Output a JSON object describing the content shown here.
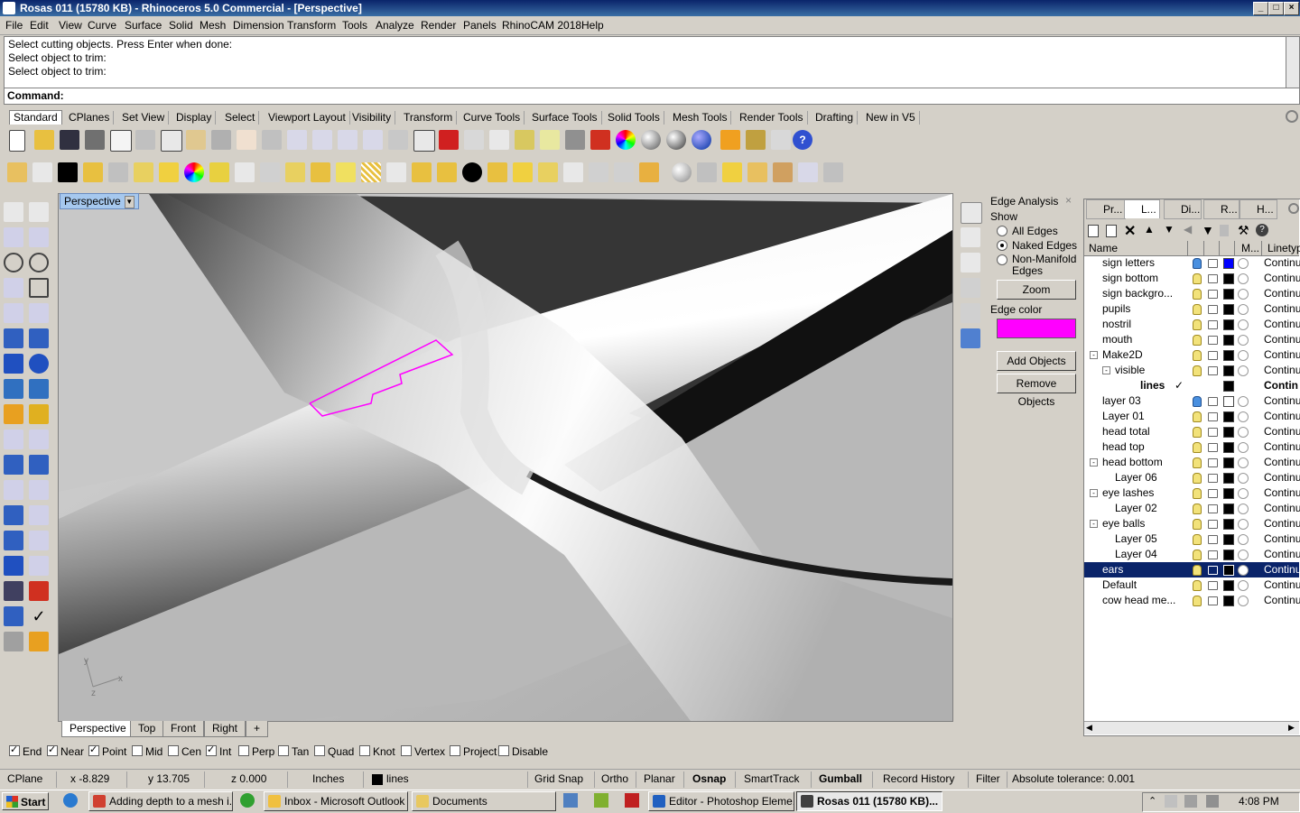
{
  "window": {
    "title": "Rosas 011 (15780 KB) - Rhinoceros 5.0 Commercial - [Perspective]",
    "controls": [
      "_",
      "□",
      "×"
    ]
  },
  "menu": [
    "File",
    "Edit",
    "View",
    "Curve",
    "Surface",
    "Solid",
    "Mesh",
    "Dimension",
    "Transform",
    "Tools",
    "Analyze",
    "Render",
    "Panels",
    "RhinoCAM 2018",
    "Help"
  ],
  "command": {
    "history": [
      "Select cutting objects. Press Enter when done:",
      "Select object to trim:",
      "Select object to trim:"
    ],
    "prompt": "Command:"
  },
  "toolbar_tabs": [
    "Standard",
    "CPlanes",
    "Set View",
    "Display",
    "Select",
    "Viewport Layout",
    "Visibility",
    "Transform",
    "Curve Tools",
    "Surface Tools",
    "Solid Tools",
    "Mesh Tools",
    "Render Tools",
    "Drafting",
    "New in V5"
  ],
  "viewport": {
    "title": "Perspective",
    "tabs": [
      "Perspective",
      "Top",
      "Front",
      "Right",
      "+"
    ],
    "axis_x": "x",
    "axis_y": "y",
    "axis_z": "z"
  },
  "edge_panel": {
    "title": "Edge Analysis",
    "close": "×",
    "show_label": "Show",
    "options": [
      "All Edges",
      "Naked Edges",
      "Non-Manifold Edges"
    ],
    "selected": "Naked Edges",
    "zoom": "Zoom",
    "edge_color_label": "Edge color",
    "edge_color": "#ff00ff",
    "add": "Add Objects",
    "remove": "Remove Objects"
  },
  "layers_panel": {
    "tabs": [
      "Pr...",
      "L...",
      "Di...",
      "R...",
      "H..."
    ],
    "col_name": "Name",
    "col_mat": "M...",
    "col_linetype": "Linetyp",
    "rows": [
      {
        "name": "sign letters",
        "indent": 0,
        "color": "#0000ff",
        "linetype": "Continu",
        "bulb": "blue"
      },
      {
        "name": "sign bottom",
        "indent": 0,
        "color": "#000000",
        "linetype": "Continu"
      },
      {
        "name": "sign backgro...",
        "indent": 0,
        "color": "#000000",
        "linetype": "Continu"
      },
      {
        "name": "pupils",
        "indent": 0,
        "color": "#000000",
        "linetype": "Continu"
      },
      {
        "name": "nostril",
        "indent": 0,
        "color": "#000000",
        "linetype": "Continu"
      },
      {
        "name": "mouth",
        "indent": 0,
        "color": "#000000",
        "linetype": "Continu"
      },
      {
        "name": "Make2D",
        "indent": 0,
        "color": "#000000",
        "linetype": "Continu",
        "tree": "⊟"
      },
      {
        "name": "visible",
        "indent": 1,
        "color": "#000000",
        "linetype": "Continu",
        "tree": "⊟"
      },
      {
        "name": "lines",
        "indent": 2,
        "color": "#000000",
        "linetype": "Contin",
        "current": true,
        "check": "✓"
      },
      {
        "name": "layer 03",
        "indent": 0,
        "color": "#ffffff",
        "linetype": "Continu",
        "bulb": "blue"
      },
      {
        "name": "Layer 01",
        "indent": 0,
        "color": "#000000",
        "linetype": "Continu"
      },
      {
        "name": "head total",
        "indent": 0,
        "color": "#000000",
        "linetype": "Continu"
      },
      {
        "name": "head top",
        "indent": 0,
        "color": "#000000",
        "linetype": "Continu"
      },
      {
        "name": "head bottom",
        "indent": 0,
        "color": "#000000",
        "linetype": "Continu",
        "tree": "⊟"
      },
      {
        "name": "Layer 06",
        "indent": 1,
        "color": "#000000",
        "linetype": "Continu"
      },
      {
        "name": "eye lashes",
        "indent": 0,
        "color": "#000000",
        "linetype": "Continu",
        "tree": "⊟"
      },
      {
        "name": "Layer 02",
        "indent": 1,
        "color": "#000000",
        "linetype": "Continu"
      },
      {
        "name": "eye balls",
        "indent": 0,
        "color": "#000000",
        "linetype": "Continu",
        "tree": "⊟"
      },
      {
        "name": "Layer 05",
        "indent": 1,
        "color": "#000000",
        "linetype": "Continu"
      },
      {
        "name": "Layer 04",
        "indent": 1,
        "color": "#000000",
        "linetype": "Continu"
      },
      {
        "name": "ears",
        "indent": 0,
        "color": "#000000",
        "linetype": "Continu",
        "selected": true
      },
      {
        "name": "Default",
        "indent": 0,
        "color": "#000000",
        "linetype": "Continu"
      },
      {
        "name": "cow head me...",
        "indent": 0,
        "color": "#000000",
        "linetype": "Continu"
      }
    ]
  },
  "osnap": [
    {
      "label": "End",
      "on": true
    },
    {
      "label": "Near",
      "on": true
    },
    {
      "label": "Point",
      "on": true
    },
    {
      "label": "Mid",
      "on": false
    },
    {
      "label": "Cen",
      "on": false
    },
    {
      "label": "Int",
      "on": true
    },
    {
      "label": "Perp",
      "on": false
    },
    {
      "label": "Tan",
      "on": false
    },
    {
      "label": "Quad",
      "on": false
    },
    {
      "label": "Knot",
      "on": false
    },
    {
      "label": "Vertex",
      "on": false
    },
    {
      "label": "Project",
      "on": false
    },
    {
      "label": "Disable",
      "on": false
    }
  ],
  "status": {
    "cplane": "CPlane",
    "x": "x -8.829",
    "y": "y 13.705",
    "z": "z 0.000",
    "units": "Inches",
    "layer": "lines",
    "grid_snap": "Grid Snap",
    "ortho": "Ortho",
    "planar": "Planar",
    "osnap": "Osnap",
    "smarttrack": "SmartTrack",
    "gumball": "Gumball",
    "record_history": "Record History",
    "filter": "Filter",
    "tolerance": "Absolute tolerance: 0.001"
  },
  "taskbar": {
    "start": "Start",
    "tasks": [
      {
        "label": "Adding depth to a mesh i...",
        "color": "#d04030"
      },
      {
        "label": "Inbox - Microsoft Outlook",
        "color": "#f0c040"
      },
      {
        "label": "Documents",
        "color": "#e8c860"
      },
      {
        "label": "Editor - Photoshop Eleme...",
        "color": "#2060c0"
      },
      {
        "label": "Rosas 011 (15780 KB)...",
        "color": "#404040",
        "active": true
      }
    ],
    "clock": "4:08 PM"
  },
  "colors": {
    "titlebar": "#0a246a",
    "selection": "#0a246a",
    "naked_edge": "#ff00ff"
  }
}
